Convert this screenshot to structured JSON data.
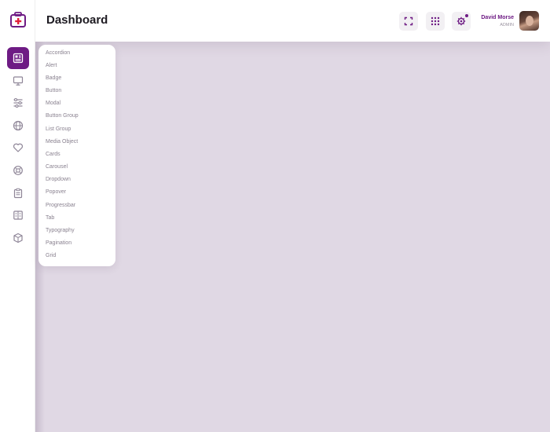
{
  "header": {
    "title": "Dashboard",
    "user_name": "David Morse",
    "user_role": "ADMIN"
  },
  "sidebar": {
    "items": [
      {
        "icon": "dashboard-icon",
        "active": true
      },
      {
        "icon": "monitor-icon"
      },
      {
        "icon": "sliders-icon"
      },
      {
        "icon": "globe-icon"
      },
      {
        "icon": "heart-icon"
      },
      {
        "icon": "support-icon"
      },
      {
        "icon": "clipboard-icon"
      },
      {
        "icon": "document-icon"
      },
      {
        "icon": "cube-icon"
      }
    ]
  },
  "menu": {
    "items": [
      "Accordion",
      "Alert",
      "Badge",
      "Button",
      "Modal",
      "Button Group",
      "List Group",
      "Media Object",
      "Cards",
      "Carousel",
      "Dropdown",
      "Popover",
      "Progressbar",
      "Tab",
      "Typography",
      "Pagination",
      "Grid"
    ]
  },
  "colors": {
    "accent": "#6e1b84",
    "background": "#e0d8e4",
    "logo_red": "#e0203a"
  }
}
